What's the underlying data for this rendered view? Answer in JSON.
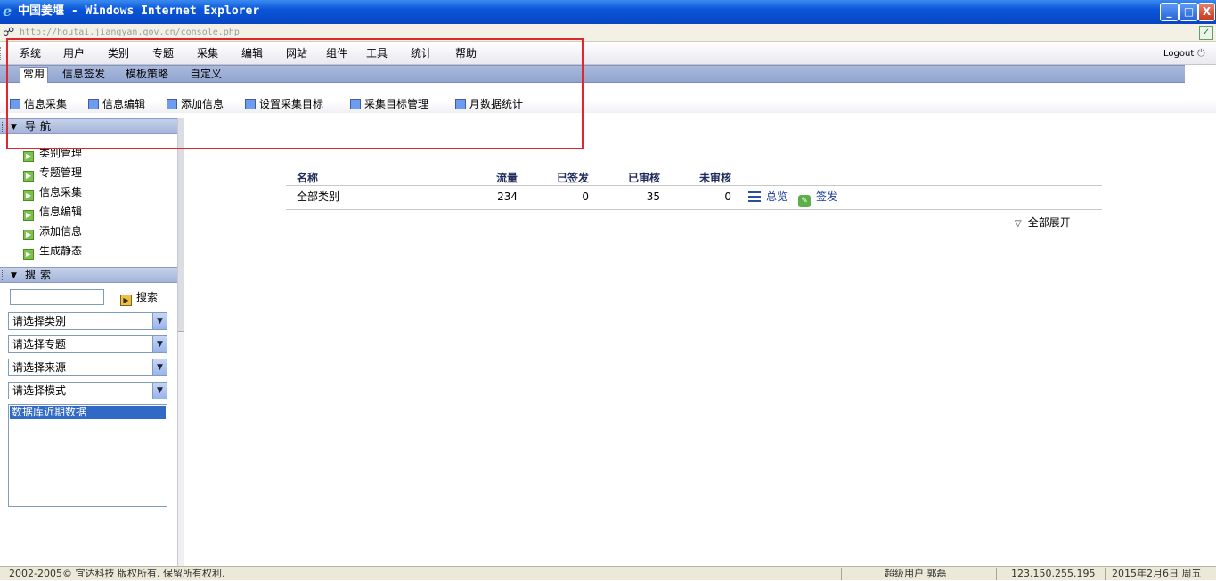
{
  "window": {
    "title": "中国姜堰 - Windows Internet Explorer",
    "ie_logo": "e",
    "url": "http://houtai.jiangyan.gov.cn/console.php",
    "minimize_glyph": "_",
    "maximize_glyph": "□",
    "close_glyph": "X"
  },
  "menu": {
    "items": [
      "系统",
      "用户",
      "类别",
      "专题",
      "采集",
      "编辑",
      "网站",
      "组件",
      "工具",
      "统计",
      "帮助"
    ],
    "logout_label": "Logout",
    "logout_icon_glyph": "⏻"
  },
  "subtabs": {
    "items": [
      "常用",
      "信息签发",
      "模板策略",
      "自定义"
    ],
    "active_index": 0
  },
  "toolbar": {
    "items": [
      "信息采集",
      "信息编辑",
      "添加信息",
      "设置采集目标",
      "采集目标管理",
      "月数据统计"
    ]
  },
  "sidebar": {
    "nav_header": "导航",
    "nav_items": [
      "类别管理",
      "专题管理",
      "信息采集",
      "信息编辑",
      "添加信息",
      "生成静态"
    ],
    "search_header": "搜索",
    "search_input_value": "",
    "search_button_label": "搜索",
    "selects": [
      {
        "value": "请选择类别"
      },
      {
        "value": "请选择专题"
      },
      {
        "value": "请选择来源"
      },
      {
        "value": "请选择模式"
      }
    ],
    "listbox_options": [
      "数据库近期数据"
    ]
  },
  "table": {
    "headers": {
      "name": "名称",
      "traffic": "流量",
      "published": "已签发",
      "reviewed": "已审核",
      "unreviewed": "未审核"
    },
    "rows": [
      {
        "name": "全部类别",
        "traffic": "234",
        "published": "0",
        "reviewed": "35",
        "unreviewed": "0",
        "action_overview": "总览",
        "action_publish": "签发"
      }
    ],
    "expand_all": "全部展开"
  },
  "statusbar": {
    "copyright": "2002-2005© 宜达科技 版权所有, 保留所有权利.",
    "user": "超级用户 郭磊",
    "ip": "123.150.255.195",
    "date": "2015年2月6日 周五"
  },
  "colors": {
    "highlight_box": "#e0262e",
    "titlebar": "#0a55d8",
    "subtab_band": "#9aaad4",
    "link": "#1a3c9a",
    "selection": "#316ac5"
  }
}
